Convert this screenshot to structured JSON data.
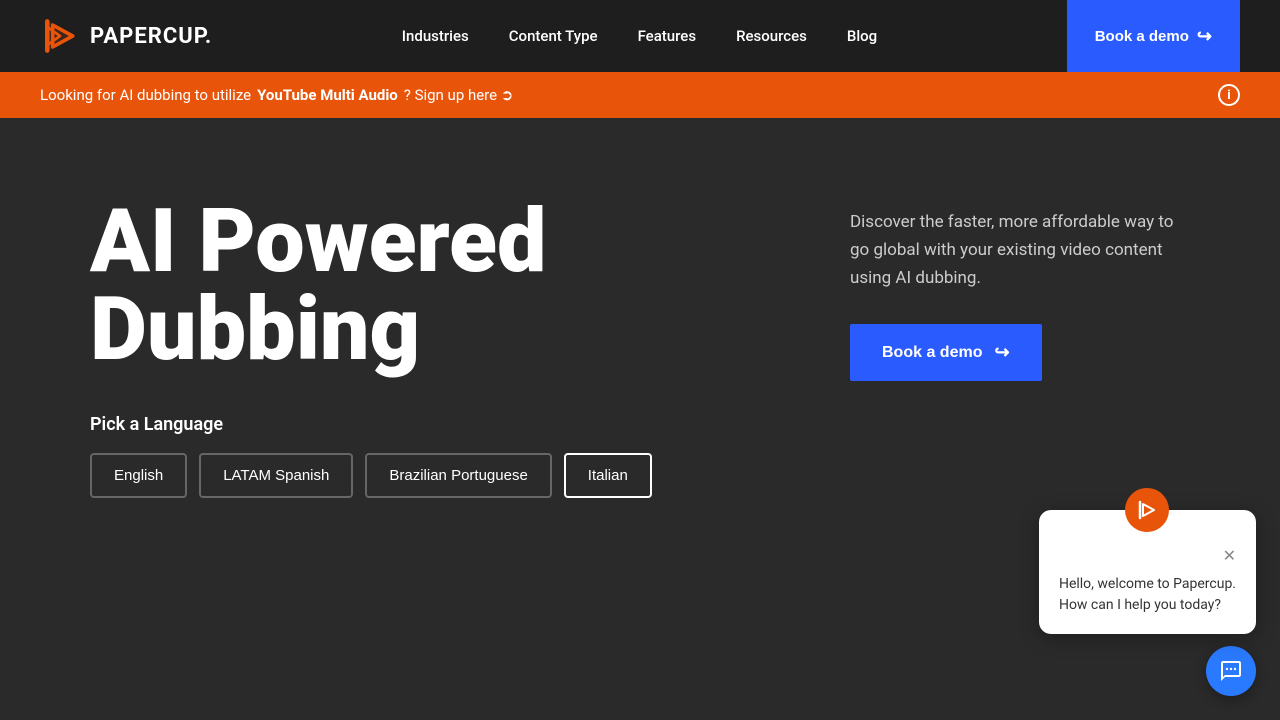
{
  "brand": {
    "name": "PAPERCUP.",
    "tagline": "AI Dubbing"
  },
  "navbar": {
    "links": [
      {
        "label": "Industries",
        "id": "industries"
      },
      {
        "label": "Content Type",
        "id": "content-type"
      },
      {
        "label": "Features",
        "id": "features"
      },
      {
        "label": "Resources",
        "id": "resources"
      },
      {
        "label": "Blog",
        "id": "blog"
      }
    ],
    "cta_label": "Book a demo"
  },
  "banner": {
    "text_before": "Looking for AI dubbing to utilize",
    "highlight": "YouTube Multi Audio",
    "text_after": "? Sign up here ➲"
  },
  "hero": {
    "title_line1": "AI Powered",
    "title_line2": "Dubbing",
    "description": "Discover the faster, more affordable way to go global with your existing video content using AI dubbing.",
    "cta_label": "Book a demo",
    "pick_language_label": "Pick a Language",
    "languages": [
      {
        "label": "English",
        "active": false
      },
      {
        "label": "LATAM Spanish",
        "active": false
      },
      {
        "label": "Brazilian Portuguese",
        "active": false
      },
      {
        "label": "Italian",
        "active": true
      }
    ]
  },
  "chat": {
    "greeting": "Hello, welcome to Papercup.",
    "subtext": "How can I help you today?"
  },
  "colors": {
    "brand_orange": "#e8540a",
    "brand_blue": "#2a5bff",
    "bg_dark": "#2a2a2a",
    "nav_bg": "#1e1e1e"
  }
}
